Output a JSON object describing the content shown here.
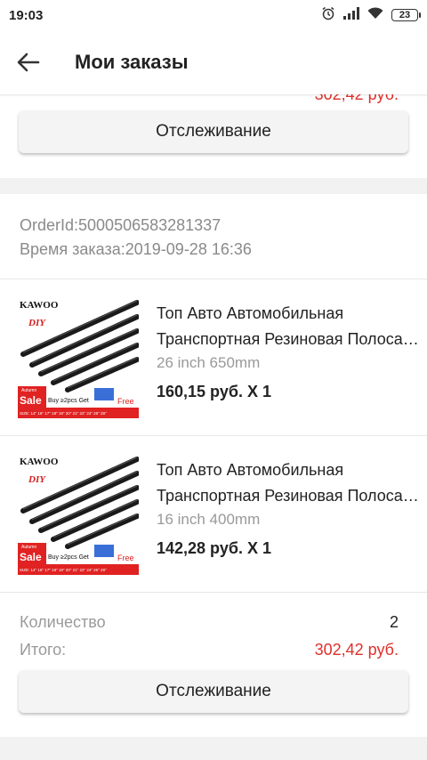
{
  "status_bar": {
    "time": "19:03",
    "battery": "23",
    "icons": [
      "alarm-icon",
      "signal-icon",
      "wifi-icon",
      "battery-icon"
    ]
  },
  "header": {
    "title": "Мои заказы",
    "back_icon": "arrow-left-icon"
  },
  "prev_order": {
    "cut_price": "302,42 руб.",
    "track_label": "Отслеживание"
  },
  "order": {
    "order_id_text": "OrderId:5000506583281337",
    "order_time_text": "Время заказа:2019-09-28 16:36",
    "items": [
      {
        "title_line1": "Топ Авто Автомобильная",
        "title_line2": "Транспортная Резиновая Полоса для щёток",
        "variant": "26 inch 650mm",
        "price": "160,15 руб. X 1",
        "thumb": {
          "brand": "KAWOO",
          "tag": "DIY",
          "sale_small": "Autumn",
          "sale_big": "Sale",
          "promo": "Buy ≥2pcs Get",
          "free": "Free",
          "sizes": "SIZE: 14\" 16\" 17\" 18\" 19\" 20\" 21\" 22\" 24\" 26\" 28\""
        }
      },
      {
        "title_line1": "Топ Авто Автомобильная",
        "title_line2": "Транспортная Резиновая Полоса для щёток",
        "variant": "16 inch 400mm",
        "price": "142,28 руб. X 1",
        "thumb": {
          "brand": "KAWOO",
          "tag": "DIY",
          "sale_small": "Autumn",
          "sale_big": "Sale",
          "promo": "Buy ≥2pcs Get",
          "free": "Free",
          "sizes": "SIZE: 14\" 16\" 17\" 18\" 19\" 20\" 21\" 22\" 24\" 26\" 28\""
        }
      }
    ],
    "quantity_label": "Количество",
    "quantity_value": "2",
    "total_label": "Итого:",
    "total_value": "302,42 руб.",
    "track_label": "Отслеживание"
  },
  "colors": {
    "accent_red": "#e0302b",
    "muted_text": "#8a8a8a",
    "background": "#f2f2f2"
  }
}
